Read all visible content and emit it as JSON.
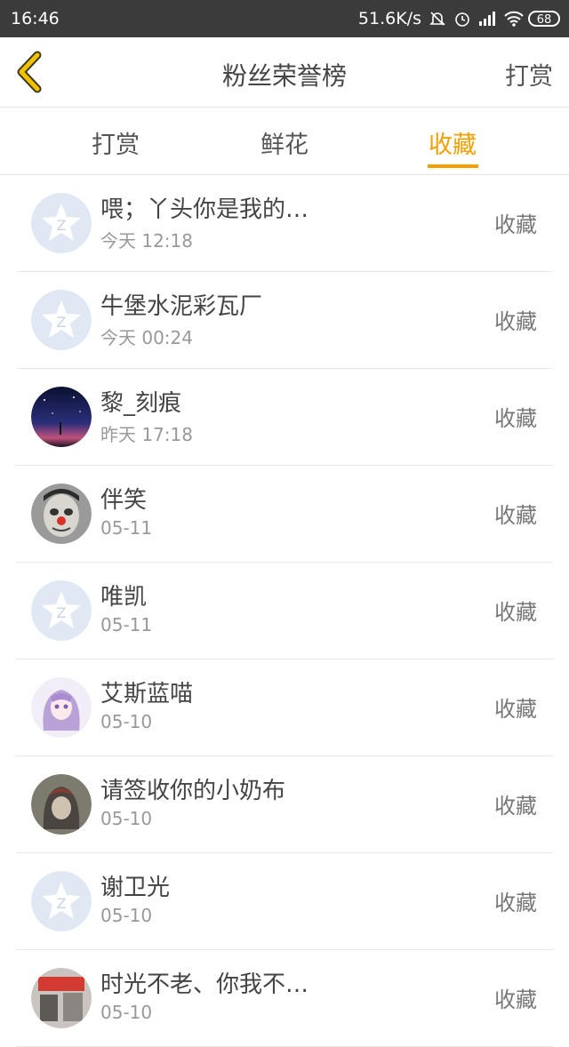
{
  "status_bar": {
    "time": "16:46",
    "network_speed": "51.6K/s",
    "battery": "68",
    "icons": [
      "bell-off-icon",
      "alarm-icon",
      "signal-icon",
      "wifi-icon",
      "battery-icon"
    ]
  },
  "header": {
    "back_icon": "chevron-left-icon",
    "title": "粉丝荣誉榜",
    "action": "打赏"
  },
  "tabs": [
    {
      "label": "打赏",
      "active": false
    },
    {
      "label": "鲜花",
      "active": false
    },
    {
      "label": "收藏",
      "active": true
    }
  ],
  "colors": {
    "accent": "#f2a000",
    "status_bar": "#3b3b3b"
  },
  "fans": [
    {
      "name": "喂；丫头你是我的…",
      "time": "今天 12:18",
      "action": "收藏",
      "avatar": "default-star-avatar"
    },
    {
      "name": "牛堡水泥彩瓦厂",
      "time": "今天 00:24",
      "action": "收藏",
      "avatar": "default-star-avatar"
    },
    {
      "name": "黎_刻痕",
      "time": "昨天 17:18",
      "action": "收藏",
      "avatar": "night-sky-avatar"
    },
    {
      "name": "伴笑",
      "time": "05-11",
      "action": "收藏",
      "avatar": "clown-face-avatar"
    },
    {
      "name": "唯凯",
      "time": "05-11",
      "action": "收藏",
      "avatar": "default-star-avatar"
    },
    {
      "name": "艾斯蓝喵",
      "time": "05-10",
      "action": "收藏",
      "avatar": "anime-girl-avatar"
    },
    {
      "name": "请签收你的小奶布",
      "time": "05-10",
      "action": "收藏",
      "avatar": "hooded-person-avatar"
    },
    {
      "name": "谢卫光",
      "time": "05-10",
      "action": "收藏",
      "avatar": "default-star-avatar"
    },
    {
      "name": "时光不老、你我不…",
      "time": "05-10",
      "action": "收藏",
      "avatar": "street-photo-avatar"
    }
  ]
}
